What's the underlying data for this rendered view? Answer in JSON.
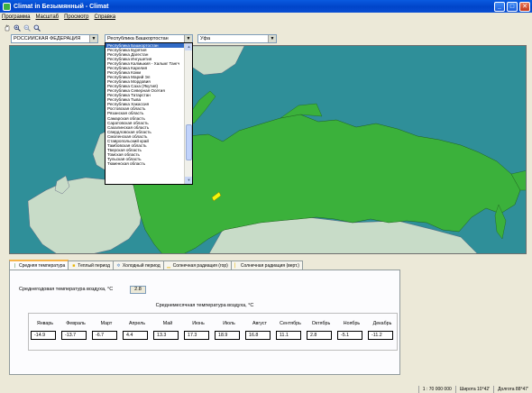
{
  "window": {
    "title": "Climat in Безымянный - Climat",
    "buttons": {
      "minimize": "_",
      "maximize": "□",
      "close": "✕"
    }
  },
  "menu": [
    "Программа",
    "Масштаб",
    "Просмотр",
    "Справка"
  ],
  "toolbar": {
    "icons": [
      "hand-pan-icon",
      "zoom-in-icon",
      "zoom-out-icon",
      "zoom-extent-icon"
    ]
  },
  "combos": {
    "country": "РОССИЙСКАЯ ФЕДЕРАЦИЯ",
    "region": "Республика Башкортостан",
    "city": "Уфа"
  },
  "dropdown": {
    "selected_index": 0,
    "items": [
      "Республика Башкортостан",
      "Республика Бурятия",
      "Республика Дагестан",
      "Республика Ингушетия",
      "Республика Калмыкия - Хальмг Тангч",
      "Республика Карелия",
      "Республика Коми",
      "Республика Марий Эл",
      "Республика Мордовия",
      "Республика Саха (Якутия)",
      "Республика Северная Осетия",
      "Республика Татарстан",
      "Республика Тыва",
      "Республика Хакассия",
      "Ростовская область",
      "Рязанская область",
      "Самарская область",
      "Саратовская область",
      "Сахалинская область",
      "Свердловская область",
      "Смоленская область",
      "Ставропольский край",
      "Тамбовская область",
      "Тверская область",
      "Томская область",
      "Тульская область",
      "Тюменская область"
    ]
  },
  "tabs": [
    {
      "label": "Средняя температура",
      "icon": "thermometer-icon",
      "active": true
    },
    {
      "label": "Теплый период",
      "icon": "sun-icon",
      "active": false
    },
    {
      "label": "Холодный период",
      "icon": "snowflake-icon",
      "active": false
    },
    {
      "label": "Солнечная радиация (гор)",
      "icon": "horizontal-radiation-icon",
      "active": false
    },
    {
      "label": "Солнечная радиация (верт.)",
      "icon": "vertical-radiation-icon",
      "active": false
    }
  ],
  "panel": {
    "annual_label": "Среднегодовая температура воздуха, °С",
    "annual_value": "2.8",
    "monthly_title": "Среднемесячная температура воздуха, °С",
    "months": [
      {
        "name": "Январь",
        "value": "-14.9"
      },
      {
        "name": "Февраль",
        "value": "-13.7"
      },
      {
        "name": "Март",
        "value": "-6.7"
      },
      {
        "name": "Апрель",
        "value": "4.4"
      },
      {
        "name": "Май",
        "value": "13.3"
      },
      {
        "name": "Июнь",
        "value": "17.3"
      },
      {
        "name": "Июль",
        "value": "18.9"
      },
      {
        "name": "Август",
        "value": "16.8"
      },
      {
        "name": "Сентябрь",
        "value": "11.1"
      },
      {
        "name": "Октябрь",
        "value": "2.8"
      },
      {
        "name": "Ноябрь",
        "value": "-5.1"
      },
      {
        "name": "Декабрь",
        "value": "-11.2"
      }
    ]
  },
  "status": {
    "scale": "1 : 70 000 000",
    "latitude": "Широта 10°42'",
    "longitude": "Долгота 88°47'"
  },
  "colors": {
    "sea": "#2f8f99",
    "russia": "#3bb13b",
    "other_land": "#c8dcc8",
    "marker": "#f5f50a"
  }
}
